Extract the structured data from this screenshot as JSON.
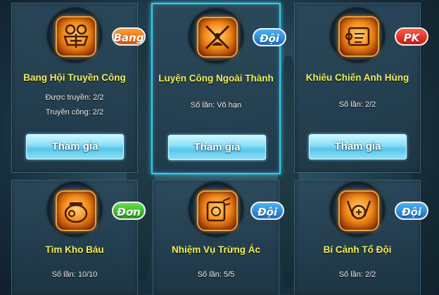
{
  "activities": [
    {
      "title": "Bang Hội Truyền Công",
      "tag": "Bang",
      "icon": "guild-pass-icon",
      "info_lines": [
        "Được truyền: 2/2",
        "Truyền công: 2/2"
      ],
      "button": "Tham gia"
    },
    {
      "title": "Luyện Công Ngoài Thành",
      "tag": "Đội",
      "icon": "crossed-swords-meditation-icon",
      "info_lines": [
        "Số lần: Vô hạn"
      ],
      "button": "Tham gia",
      "selected": true
    },
    {
      "title": "Khiêu Chiến Anh Hùng",
      "tag": "PK",
      "icon": "scroll-challenge-icon",
      "info_lines": [
        "Số lần: 2/2"
      ],
      "button": "Tham gia"
    },
    {
      "title": "Tìm Kho Báu",
      "tag": "Đơn",
      "icon": "treasure-pot-icon",
      "info_lines": [
        "Số lần: 10/10"
      ]
    },
    {
      "title": "Nhiệm Vụ Trừng Ác",
      "tag": "Đội",
      "icon": "punish-evil-icon",
      "info_lines": [
        "Số lần: 5/5"
      ]
    },
    {
      "title": "Bí Cảnh Tổ Đội",
      "tag": "Đội",
      "icon": "team-secret-realm-icon",
      "info_lines": [
        "Số lần: 2/2"
      ]
    }
  ],
  "colors": {
    "title": "#f5ef5c",
    "selected_border": "#35c9ee",
    "tag_orange": "#e0580c",
    "tag_blue": "#1a6ec8",
    "tag_red": "#c81a14",
    "tag_green": "#1e9a1a"
  }
}
